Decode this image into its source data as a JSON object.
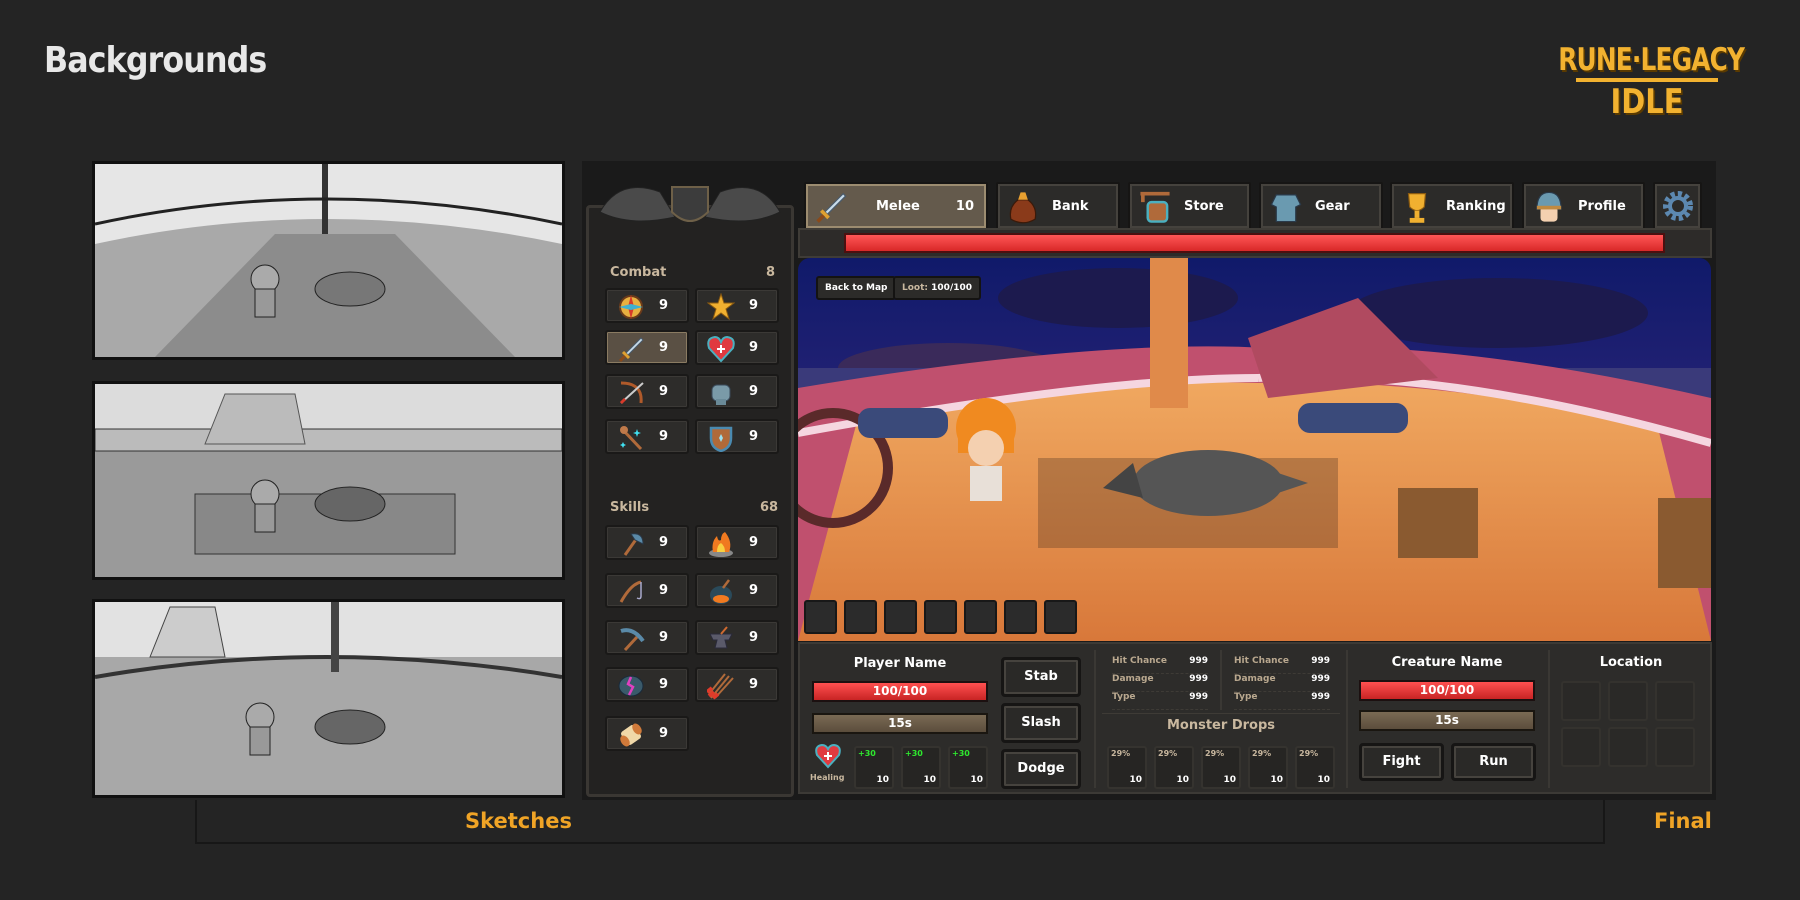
{
  "page": {
    "title": "Backgrounds",
    "logo": {
      "line1": "RUNE·LEGACY",
      "line2": "IDLE"
    },
    "sketches_label": "Sketches",
    "final_label": "Final"
  },
  "colors": {
    "background": "#242424",
    "accent_orange": "#f0a426",
    "logo_gold": "#f2b230",
    "hp_red": "#e03434",
    "timer_brown": "#6b5c48",
    "heal_green": "#2ee82e"
  },
  "tabs": [
    {
      "label": "Melee",
      "count": "10",
      "icon": "sword-icon",
      "active": true
    },
    {
      "label": "Bank",
      "icon": "money-bag-icon"
    },
    {
      "label": "Store",
      "icon": "shop-sign-icon"
    },
    {
      "label": "Gear",
      "icon": "armor-icon"
    },
    {
      "label": "Ranking",
      "icon": "trophy-icon"
    },
    {
      "label": "Profile",
      "icon": "helmet-avatar-icon"
    }
  ],
  "settings_icon": "gear-icon",
  "sidebar": {
    "combat": {
      "label": "Combat",
      "count": "8",
      "items": [
        {
          "icon": "compass-icon",
          "level": "9"
        },
        {
          "icon": "star-icon",
          "level": "9"
        },
        {
          "icon": "sword-icon",
          "level": "9",
          "selected": true
        },
        {
          "icon": "heart-icon",
          "level": "9"
        },
        {
          "icon": "bow-icon",
          "level": "9"
        },
        {
          "icon": "fist-icon",
          "level": "9"
        },
        {
          "icon": "magic-staff-icon",
          "level": "9"
        },
        {
          "icon": "shield-icon",
          "level": "9"
        }
      ]
    },
    "skills": {
      "label": "Skills",
      "count": "68",
      "items": [
        {
          "icon": "axe-icon",
          "level": "9"
        },
        {
          "icon": "campfire-icon",
          "level": "9"
        },
        {
          "icon": "fishing-rod-icon",
          "level": "9"
        },
        {
          "icon": "cauldron-icon",
          "level": "9"
        },
        {
          "icon": "pickaxe-icon",
          "level": "9"
        },
        {
          "icon": "anvil-icon",
          "level": "9"
        },
        {
          "icon": "rune-stone-icon",
          "level": "9"
        },
        {
          "icon": "arrows-icon",
          "level": "9"
        },
        {
          "icon": "thread-spool-icon",
          "level": "9"
        }
      ]
    }
  },
  "scene": {
    "back_button": "Back to Map",
    "loot_label": "Loot:",
    "loot_value": "100/100",
    "enemy_hp_fraction": 1.0
  },
  "player": {
    "name": "Player Name",
    "hp": "100/100",
    "hp_fraction": 1.0,
    "timer": "15s",
    "healing_label": "Healing",
    "potions": [
      {
        "bonus": "+30",
        "qty": "10"
      },
      {
        "bonus": "+30",
        "qty": "10"
      },
      {
        "bonus": "+30",
        "qty": "10"
      }
    ],
    "actions": [
      "Stab",
      "Slash",
      "Dodge"
    ]
  },
  "stats": [
    [
      {
        "label": "Hit Chance",
        "value": "999"
      },
      {
        "label": "Damage",
        "value": "999"
      },
      {
        "label": "Type",
        "value": "999"
      }
    ],
    [
      {
        "label": "Hit Chance",
        "value": "999"
      },
      {
        "label": "Damage",
        "value": "999"
      },
      {
        "label": "Type",
        "value": "999"
      }
    ]
  ],
  "drops": {
    "title": "Monster Drops",
    "items": [
      {
        "chance": "29%",
        "qty": "10"
      },
      {
        "chance": "29%",
        "qty": "10"
      },
      {
        "chance": "29%",
        "qty": "10"
      },
      {
        "chance": "29%",
        "qty": "10"
      },
      {
        "chance": "29%",
        "qty": "10"
      }
    ]
  },
  "creature": {
    "name": "Creature Name",
    "hp": "100/100",
    "hp_fraction": 1.0,
    "timer": "15s",
    "actions": [
      "Fight",
      "Run"
    ]
  },
  "location": {
    "title": "Location"
  }
}
